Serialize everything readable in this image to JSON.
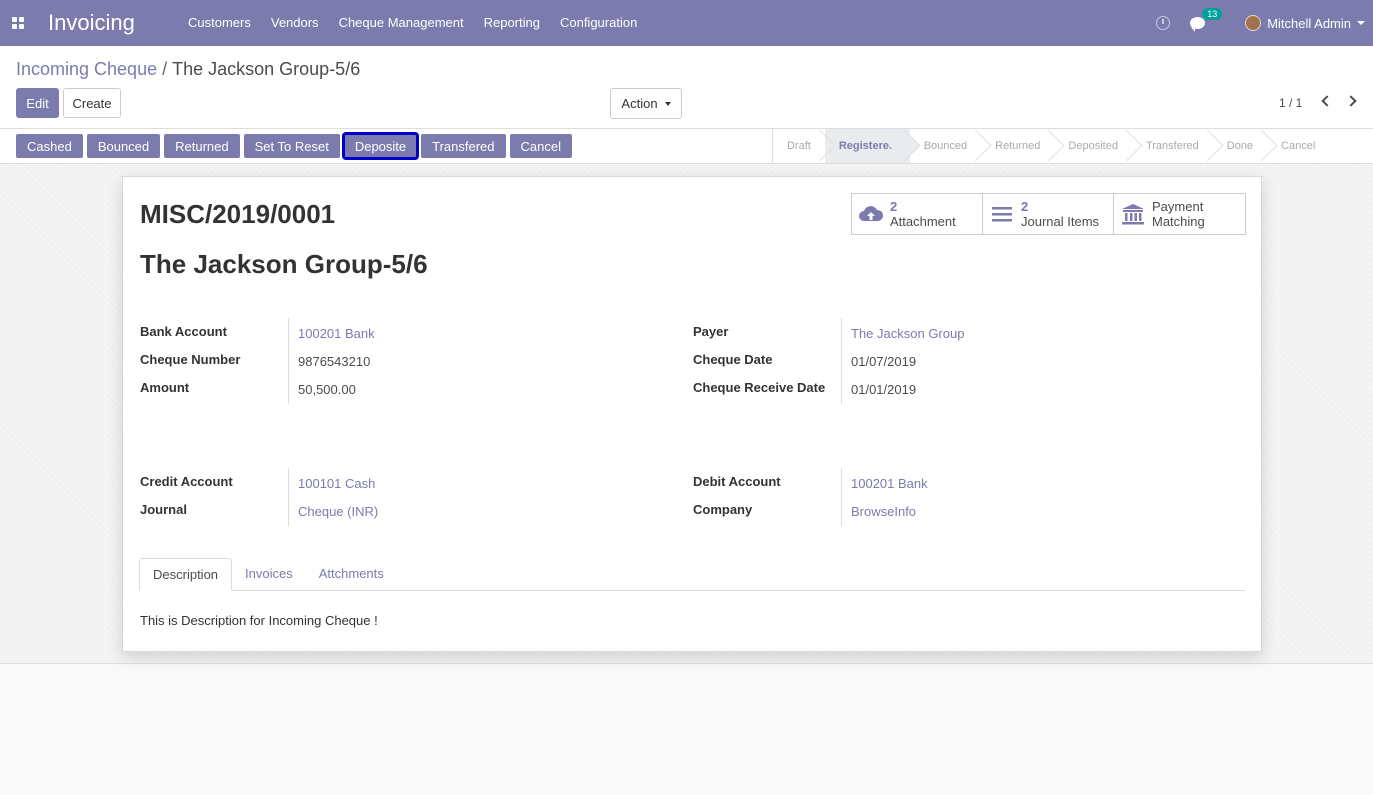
{
  "navbar": {
    "app_name": "Invoicing",
    "menu": [
      "Customers",
      "Vendors",
      "Cheque Management",
      "Reporting",
      "Configuration"
    ],
    "chat_count": "13",
    "user_name": "Mitchell Admin"
  },
  "control_panel": {
    "breadcrumb_parent": "Incoming Cheque",
    "breadcrumb_separator": "/",
    "breadcrumb_current": "The Jackson Group-5/6",
    "edit_label": "Edit",
    "create_label": "Create",
    "action_label": "Action",
    "pager": "1 / 1"
  },
  "statusbar": {
    "buttons": [
      "Cashed",
      "Bounced",
      "Returned",
      "Set To Reset",
      "Deposite",
      "Transfered",
      "Cancel"
    ],
    "focused_button": "Deposite",
    "stages": [
      "Draft",
      "Registered",
      "Bounced",
      "Returned",
      "Deposited",
      "Transfered",
      "Done",
      "Cancel"
    ],
    "active_stage": "Registered"
  },
  "smart_buttons": [
    {
      "count": "2",
      "label": "Attachment",
      "icon": "cloud-upload-icon"
    },
    {
      "count": "2",
      "label": "Journal Items",
      "icon": "list-icon"
    },
    {
      "count": "Payment",
      "label": "Matching",
      "icon": "bank-icon"
    }
  ],
  "record": {
    "reference": "MISC/2019/0001",
    "name": "The Jackson Group-5/6"
  },
  "fields": {
    "left_top": [
      {
        "label": "Bank Account",
        "value": "100201 Bank",
        "link": true
      },
      {
        "label": "Cheque Number",
        "value": "9876543210",
        "link": false
      },
      {
        "label": "Amount",
        "value": "50,500.00",
        "link": false
      }
    ],
    "right_top": [
      {
        "label": "Payer",
        "value": "The Jackson Group",
        "link": true
      },
      {
        "label": "Cheque Date",
        "value": "01/07/2019",
        "link": false
      },
      {
        "label": "Cheque Receive Date",
        "value": "01/01/2019",
        "link": false
      }
    ],
    "left_bottom": [
      {
        "label": "Credit Account",
        "value": "100101 Cash",
        "link": true
      },
      {
        "label": "Journal",
        "value": "Cheque (INR)",
        "link": true
      }
    ],
    "right_bottom": [
      {
        "label": "Debit Account",
        "value": "100201 Bank",
        "link": true
      },
      {
        "label": "Company",
        "value": "BrowseInfo",
        "link": true
      }
    ]
  },
  "tabs": [
    "Description",
    "Invoices",
    "Attchments"
  ],
  "active_tab": "Description",
  "description": "This is Description for Incoming Cheque !",
  "colors": {
    "primary": "#7c7bad",
    "focus_outline": "#0000cc",
    "badge": "#00a09d"
  }
}
